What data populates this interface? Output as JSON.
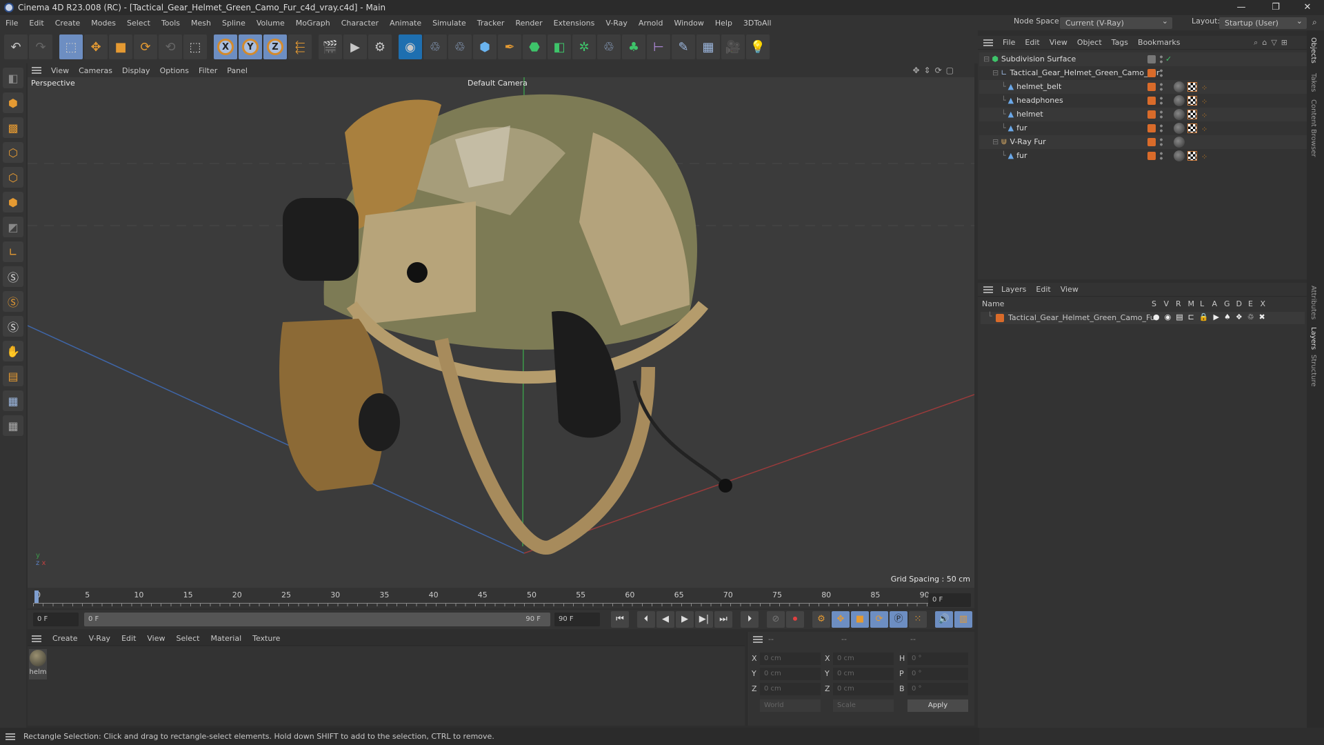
{
  "title": "Cinema 4D R23.008 (RC) - [Tactical_Gear_Helmet_Green_Camo_Fur_c4d_vray.c4d] - Main",
  "window_controls": [
    "—",
    "❐",
    "✕"
  ],
  "menu": [
    "File",
    "Edit",
    "Create",
    "Modes",
    "Select",
    "Tools",
    "Mesh",
    "Spline",
    "Volume",
    "MoGraph",
    "Character",
    "Animate",
    "Simulate",
    "Tracker",
    "Render",
    "Extensions",
    "V-Ray",
    "Arnold",
    "Window",
    "Help",
    "3DToAll"
  ],
  "node_space": {
    "label": "Node Space:",
    "value": "Current (V-Ray)"
  },
  "layout": {
    "label": "Layout:",
    "value": "Startup (User)"
  },
  "viewport": {
    "menu": [
      "View",
      "Cameras",
      "Display",
      "Options",
      "Filter",
      "Panel"
    ],
    "view_name": "Perspective",
    "camera": "Default Camera",
    "grid_spacing": "Grid Spacing : 50 cm"
  },
  "timeline": {
    "ticks": [
      "0",
      "5",
      "10",
      "15",
      "20",
      "25",
      "30",
      "35",
      "40",
      "45",
      "50",
      "55",
      "60",
      "65",
      "70",
      "75",
      "80",
      "85",
      "90"
    ],
    "current_frame": "0 F",
    "start": "0 F",
    "range_start": "0 F",
    "range_end": "90 F",
    "end": "90 F"
  },
  "material_menu": [
    "Create",
    "V-Ray",
    "Edit",
    "View",
    "Select",
    "Material",
    "Texture"
  ],
  "materials": [
    {
      "name": "helm"
    }
  ],
  "coords": {
    "headers": [
      "--",
      "--",
      "--"
    ],
    "rows": [
      {
        "a": "X",
        "av": "0 cm",
        "b": "X",
        "bv": "0 cm",
        "c": "H",
        "cv": "0 °"
      },
      {
        "a": "Y",
        "av": "0 cm",
        "b": "Y",
        "bv": "0 cm",
        "c": "P",
        "cv": "0 °"
      },
      {
        "a": "Z",
        "av": "0 cm",
        "b": "Z",
        "bv": "0 cm",
        "c": "B",
        "cv": "0 °"
      }
    ],
    "space": "World",
    "mode": "Scale",
    "apply": "Apply"
  },
  "status": "Rectangle Selection: Click and drag to rectangle-select elements. Hold down SHIFT to add to the selection, CTRL to remove.",
  "objects": {
    "menu": [
      "File",
      "Edit",
      "View",
      "Object",
      "Tags",
      "Bookmarks"
    ],
    "items": [
      {
        "name": "Subdivision Surface",
        "depth": 0
      },
      {
        "name": "Tactical_Gear_Helmet_Green_Camo_Fur",
        "depth": 1
      },
      {
        "name": "helmet_belt",
        "depth": 2
      },
      {
        "name": "headphones",
        "depth": 2
      },
      {
        "name": "helmet",
        "depth": 2
      },
      {
        "name": "fur",
        "depth": 2
      },
      {
        "name": "V-Ray Fur",
        "depth": 1
      },
      {
        "name": "fur",
        "depth": 2
      }
    ]
  },
  "layers": {
    "menu": [
      "Layers",
      "Edit",
      "View"
    ],
    "columns": [
      "Name",
      "S",
      "V",
      "R",
      "M",
      "L",
      "A",
      "G",
      "D",
      "E",
      "X"
    ],
    "items": [
      {
        "name": "Tactical_Gear_Helmet_Green_Camo_Fur",
        "color": "#d96b2a"
      }
    ]
  },
  "side_tabs": [
    "Objects",
    "Takes",
    "Content Browser",
    "Attributes",
    "Layers",
    "Structure"
  ]
}
